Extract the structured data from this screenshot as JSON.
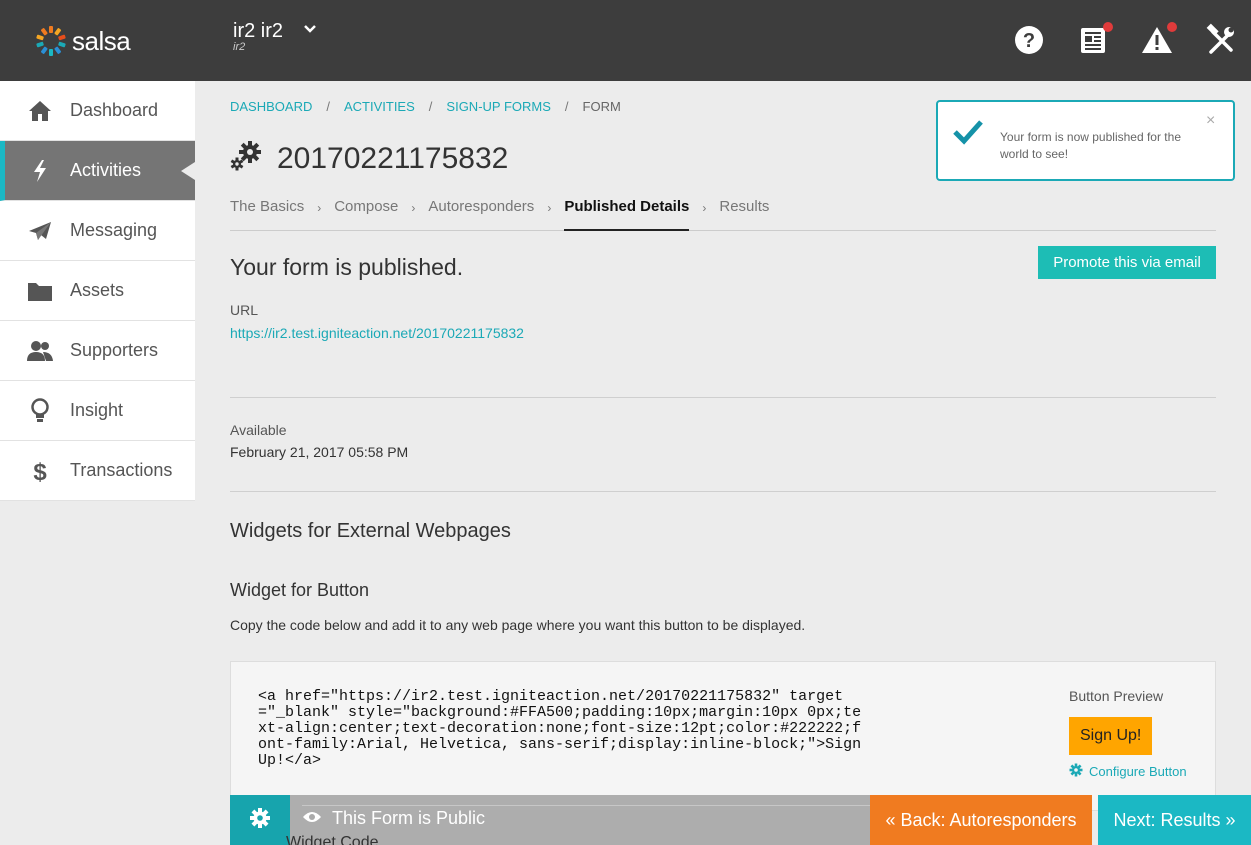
{
  "header": {
    "logo_text": "salsa",
    "org_name": "ir2 ir2",
    "org_sub": "ir2",
    "icons": [
      "chevron-down-icon",
      "help-icon",
      "news-icon",
      "alert-icon",
      "tools-icon"
    ]
  },
  "sidebar": {
    "items": [
      {
        "label": "Dashboard",
        "icon": "home-icon"
      },
      {
        "label": "Activities",
        "icon": "lightning-icon"
      },
      {
        "label": "Messaging",
        "icon": "paper-plane-icon"
      },
      {
        "label": "Assets",
        "icon": "folder-icon"
      },
      {
        "label": "Supporters",
        "icon": "people-icon"
      },
      {
        "label": "Insight",
        "icon": "lightbulb-icon"
      },
      {
        "label": "Transactions",
        "icon": "dollar-icon"
      }
    ],
    "active_index": 1
  },
  "breadcrumb": [
    "DASHBOARD",
    "ACTIVITIES",
    "SIGN-UP FORMS",
    "FORM"
  ],
  "page_title": "20170221175832",
  "tabs": [
    "The Basics",
    "Compose",
    "Autoresponders",
    "Published Details",
    "Results"
  ],
  "active_tab": "Published Details",
  "tab_separator": "›",
  "published": {
    "heading": "Your form is published.",
    "promote_label": "Promote this via email",
    "url_label": "URL",
    "url_value": "https://ir2.test.igniteaction.net/20170221175832",
    "available_label": "Available",
    "available_value": "February 21, 2017 05:58 PM"
  },
  "widgets": {
    "heading": "Widgets for External Webpages",
    "button_heading": "Widget for Button",
    "description": "Copy the code below and add it to any web page where you want this button to be displayed.",
    "code": "<a href=\"https://ir2.test.igniteaction.net/20170221175832\" target=\"_blank\" style=\"background:#FFA500;padding:10px;margin:10px 0px;text-align:center;text-decoration:none;font-size:12pt;color:#222222;font-family:Arial, Helvetica, sans-serif;display:inline-block;\">Sign Up!</a>",
    "preview_label": "Button Preview",
    "preview_button": "Sign Up!",
    "configure_label": "Configure Button"
  },
  "bottom_bar": {
    "public_label": "This Form is Public",
    "ghost_text": "Widget Code",
    "back_label": "« Back: Autoresponders",
    "next_label": "Next: Results »"
  },
  "toast": {
    "message": "Your form is now published for the world to see!",
    "close": "×"
  },
  "colors": {
    "accent": "#1ba9b6",
    "promote": "#1dbdb5",
    "back": "#f07b20",
    "preview_button_bg": "#FFA500",
    "topbar": "#3d3d3d",
    "active_nav": "#757575"
  }
}
